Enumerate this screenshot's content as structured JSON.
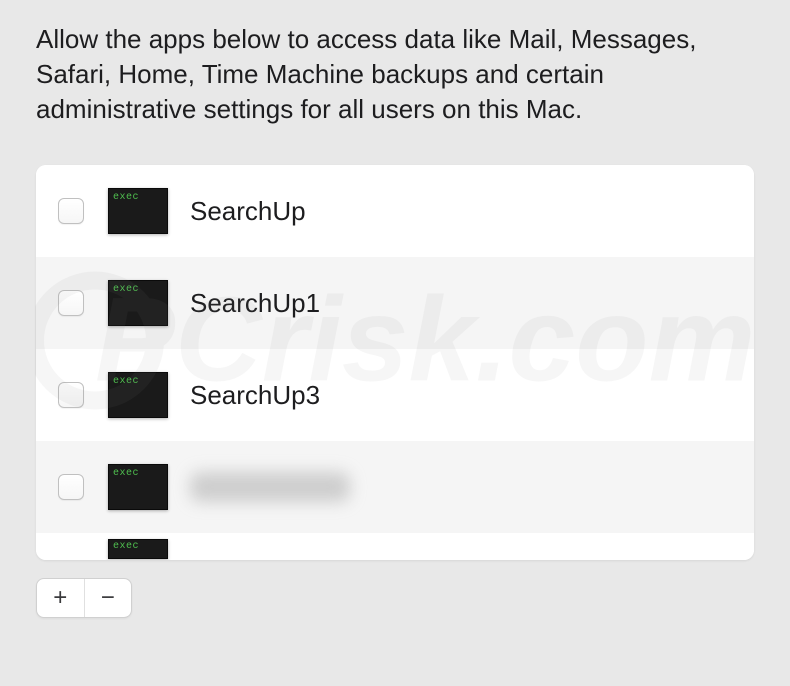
{
  "description": "Allow the apps below to access data like Mail, Messages, Safari, Home, Time Machine backups and certain administrative settings for all users on this Mac.",
  "icon_label": "exec",
  "apps": [
    {
      "name": "SearchUp",
      "checked": false,
      "blurred": false
    },
    {
      "name": "SearchUp1",
      "checked": false,
      "blurred": false
    },
    {
      "name": "SearchUp3",
      "checked": false,
      "blurred": false
    },
    {
      "name": "",
      "checked": false,
      "blurred": true
    }
  ],
  "toolbar": {
    "add": "+",
    "remove": "−"
  }
}
